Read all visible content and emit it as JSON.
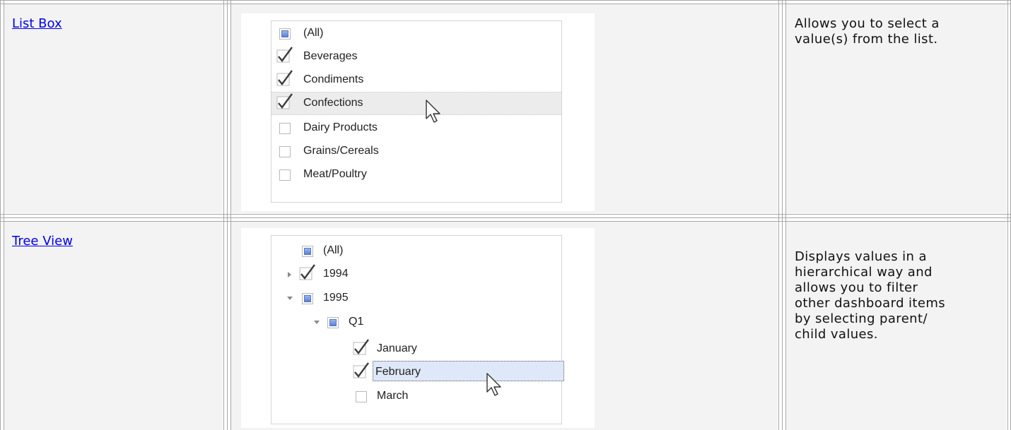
{
  "rows": [
    {
      "link": "List Box",
      "description": [
        "Allows you to select a",
        "value(s) from the list."
      ],
      "items": [
        {
          "label": "(All)",
          "state": "indeterminate"
        },
        {
          "label": "Beverages",
          "state": "checked"
        },
        {
          "label": "Condiments",
          "state": "checked"
        },
        {
          "label": "Confections",
          "state": "checked"
        },
        {
          "label": "Dairy Products",
          "state": "unchecked"
        },
        {
          "label": "Grains/Cereals",
          "state": "unchecked"
        },
        {
          "label": "Meat/Poultry",
          "state": "unchecked"
        }
      ]
    },
    {
      "link": "Tree View",
      "description": [
        "Displays values in a",
        "hierarchical way and",
        "allows you to filter",
        "other dashboard items",
        "by selecting parent/",
        "child values."
      ],
      "items": [
        {
          "label": "(All)",
          "state": "indeterminate",
          "expander": "none"
        },
        {
          "label": "1994",
          "state": "checked",
          "expander": "collapsed"
        },
        {
          "label": "1995",
          "state": "indeterminate",
          "expander": "expanded"
        },
        {
          "label": "Q1",
          "state": "indeterminate",
          "expander": "expanded"
        },
        {
          "label": "January",
          "state": "checked",
          "expander": "none"
        },
        {
          "label": "February",
          "state": "checked",
          "expander": "none"
        },
        {
          "label": "March",
          "state": "unchecked",
          "expander": "none"
        }
      ]
    }
  ]
}
